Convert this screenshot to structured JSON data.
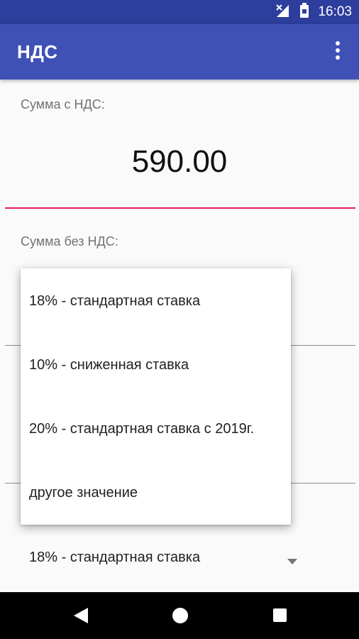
{
  "status_bar": {
    "time": "16:03"
  },
  "app_bar": {
    "title": "НДС",
    "menu_icon": "more-vert-icon"
  },
  "form": {
    "amount_with_vat_label": "Сумма с НДС:",
    "amount_with_vat_value": "590.00",
    "amount_without_vat_label": "Сумма без НДС:",
    "rate_selected": "18% - стандартная ставка"
  },
  "rate_dropdown": {
    "options": [
      "18% - стандартная ставка",
      "10% - сниженная ставка",
      "20% - стандартная ставка с 2019г.",
      "другое значение"
    ]
  },
  "colors": {
    "app_bar": "#3f51b5",
    "status_bar": "#2d3e9c",
    "accent": "#e91e63"
  }
}
